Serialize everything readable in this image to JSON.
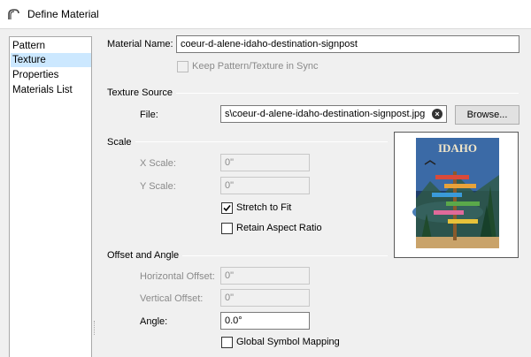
{
  "window": {
    "title": "Define Material",
    "icon": "arch-icon"
  },
  "sidebar": {
    "items": [
      {
        "label": "Pattern",
        "selected": false
      },
      {
        "label": "Texture",
        "selected": true
      },
      {
        "label": "Properties",
        "selected": false
      },
      {
        "label": "Materials List",
        "selected": false
      }
    ]
  },
  "material": {
    "name_label": "Material Name:",
    "name_value": "coeur-d-alene-idaho-destination-signpost",
    "sync_label": "Keep Pattern/Texture in Sync",
    "sync_checked": false,
    "sync_enabled": false
  },
  "texture_source": {
    "section_label": "Texture Source",
    "file_label": "File:",
    "file_value": "s\\coeur-d-alene-idaho-destination-signpost.jpg",
    "browse_label": "Browse..."
  },
  "scale": {
    "section_label": "Scale",
    "x_label": "X Scale:",
    "x_value": "0\"",
    "y_label": "Y Scale:",
    "y_value": "0\"",
    "stretch_label": "Stretch to Fit",
    "stretch_checked": true,
    "aspect_label": "Retain Aspect Ratio",
    "aspect_checked": false
  },
  "offset": {
    "section_label": "Offset and Angle",
    "h_label": "Horizontal Offset:",
    "h_value": "0\"",
    "v_label": "Vertical Offset:",
    "v_value": "0\"",
    "angle_label": "Angle:",
    "angle_value": "0.0°",
    "global_label": "Global Symbol Mapping",
    "global_checked": false
  },
  "preview": {
    "sign_text": "IDAHO"
  },
  "colors": {
    "selection": "#cce8ff",
    "disabled_text": "#8a8a8a",
    "poster_sky": "#1f3d6b",
    "poster_tree": "#1f4a2c",
    "poster_post": "#8a5a2b"
  }
}
